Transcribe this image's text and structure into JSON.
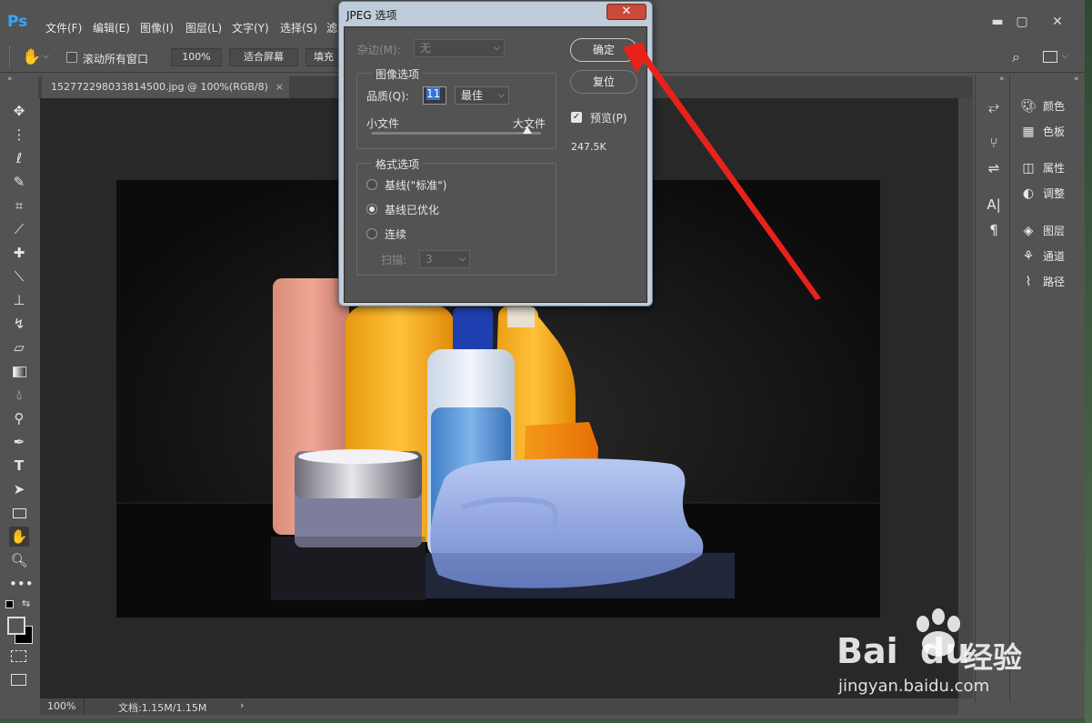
{
  "app": {
    "logo": "Ps"
  },
  "menu": [
    "文件(F)",
    "编辑(E)",
    "图像(I)",
    "图层(L)",
    "文字(Y)",
    "选择(S)",
    "滤"
  ],
  "window_controls": {
    "minimize": "▬",
    "maximize": "▢",
    "close": "✕"
  },
  "options_bar": {
    "scroll_all_label": "滚动所有窗口",
    "zoom_value": "100%",
    "fit_screen_label": "适合屏幕",
    "fill_label": "填充"
  },
  "document_tab": {
    "title": "152772298033814500.jpg @ 100%(RGB/8)",
    "close": "×"
  },
  "status_bar": {
    "zoom": "100%",
    "doc_info": "文档:1.15M/1.15M",
    "more": "›"
  },
  "right_panels": [
    {
      "icon": "palette-icon",
      "label": "颜色"
    },
    {
      "icon": "grid-icon",
      "label": "色板"
    },
    {
      "icon": "properties-icon",
      "label": "属性"
    },
    {
      "icon": "adjust-icon",
      "label": "调整"
    },
    {
      "icon": "layers-icon",
      "label": "图层"
    },
    {
      "icon": "channels-icon",
      "label": "通道"
    },
    {
      "icon": "paths-icon",
      "label": "路径"
    }
  ],
  "dialog": {
    "title": "JPEG 选项",
    "close": "✕",
    "matte_label": "杂边(M):",
    "matte_value": "无",
    "image_options_title": "图像选项",
    "quality_label": "品质(Q):",
    "quality_value": "11",
    "quality_preset": "最佳",
    "small_file": "小文件",
    "large_file": "大文件",
    "quality_fraction": 0.917,
    "format_options_title": "格式选项",
    "formats": [
      {
        "label": "基线(\"标准\")",
        "selected": false
      },
      {
        "label": "基线已优化",
        "selected": true
      },
      {
        "label": "连续",
        "selected": false
      }
    ],
    "scans_label": "扫描:",
    "scans_value": "3",
    "ok_label": "确定",
    "reset_label": "复位",
    "preview_label": "预览(P)",
    "preview_checked": true,
    "file_size": "247.5K"
  },
  "watermark": {
    "brand": "Bai",
    "brand2": "du",
    "cn": "经验",
    "url": "jingyan.baidu.com"
  },
  "colors": {
    "accent_blue": "#31a8ff",
    "arrow_red": "#e8221b",
    "dialog_frame": "#bfcddb"
  }
}
